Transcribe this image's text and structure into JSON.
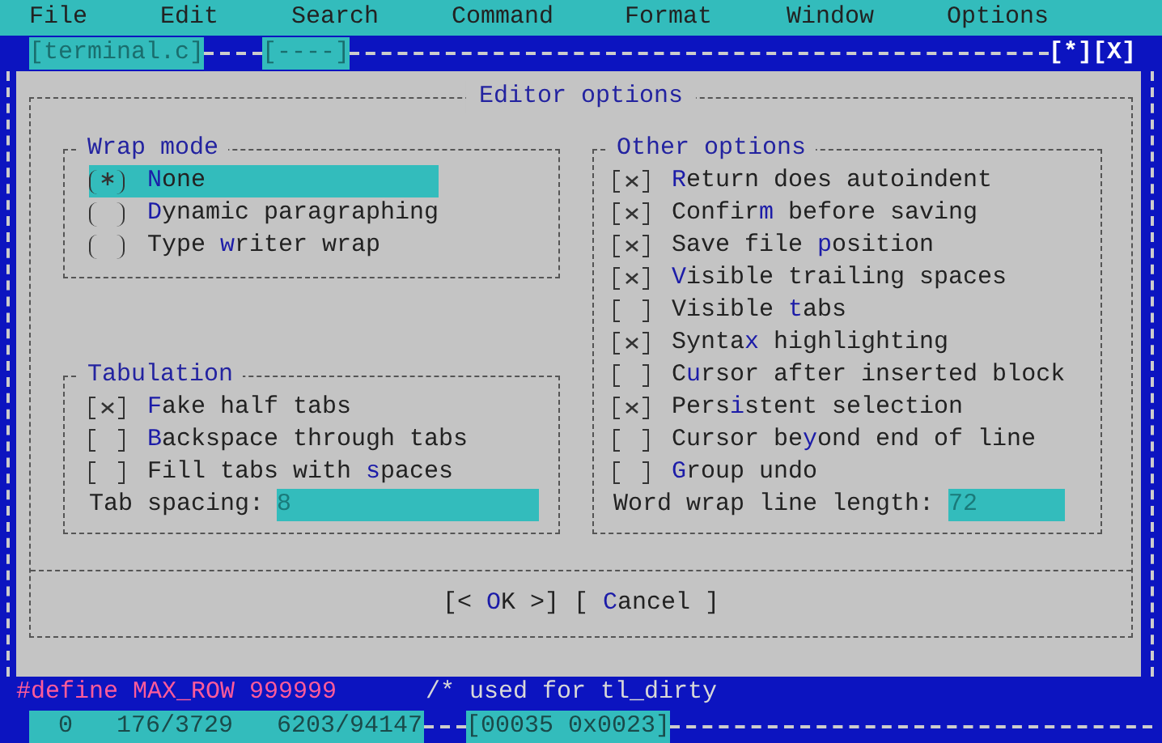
{
  "menu": [
    "File",
    "Edit",
    "Search",
    "Command",
    "Format",
    "Window",
    "Options"
  ],
  "editor_tabs": [
    {
      "label": "[terminal.c]"
    },
    {
      "label": "[----]"
    }
  ],
  "window_controls": "[*][X]",
  "dialog": {
    "title": "Editor options",
    "wrap_mode": {
      "title": "Wrap mode",
      "options": [
        {
          "label": {
            "key": "N",
            "after": "one"
          },
          "selected": true,
          "focused": true
        },
        {
          "label": {
            "key": "D",
            "after": "ynamic paragraphing"
          },
          "selected": false,
          "focused": false
        },
        {
          "label": {
            "before": "Type ",
            "key": "w",
            "after": "riter wrap"
          },
          "selected": false,
          "focused": false
        }
      ]
    },
    "tabulation": {
      "title": "Tabulation",
      "options": [
        {
          "label": {
            "key": "F",
            "after": "ake half tabs"
          },
          "checked": true
        },
        {
          "label": {
            "key": "B",
            "after": "ackspace through tabs"
          },
          "checked": false
        },
        {
          "label": {
            "before": "Fill tabs with ",
            "key": "s",
            "after": "paces"
          },
          "checked": false
        }
      ],
      "field": {
        "label": "Tab spacing:",
        "value": "8"
      }
    },
    "other": {
      "title": "Other options",
      "options": [
        {
          "label": {
            "key": "R",
            "after": "eturn does autoindent"
          },
          "checked": true
        },
        {
          "label": {
            "before": "Confir",
            "key": "m",
            "after": " before saving"
          },
          "checked": true
        },
        {
          "label": {
            "before": "Save file ",
            "key": "p",
            "after": "osition"
          },
          "checked": true
        },
        {
          "label": {
            "key": "V",
            "after": "isible trailing spaces"
          },
          "checked": true
        },
        {
          "label": {
            "before": "Visible ",
            "key": "t",
            "after": "abs"
          },
          "checked": false
        },
        {
          "label": {
            "before": "Synta",
            "key": "x",
            "after": " highlighting"
          },
          "checked": true
        },
        {
          "label": {
            "before": "C",
            "key": "u",
            "after": "rsor after inserted block"
          },
          "checked": false
        },
        {
          "label": {
            "before": "Pers",
            "key": "i",
            "after": "stent selection"
          },
          "checked": true
        },
        {
          "label": {
            "before": "Cursor be",
            "key": "y",
            "after": "ond end of line"
          },
          "checked": false
        },
        {
          "label": {
            "key": "G",
            "after": "roup undo"
          },
          "checked": false
        }
      ],
      "field": {
        "label": "Word wrap line length:",
        "value": "72"
      }
    },
    "buttons": [
      {
        "label": {
          "before": "[< ",
          "key": "O",
          "after": "K >]"
        }
      },
      {
        "label": {
          "before": "[ ",
          "key": "C",
          "after": "ancel ]"
        }
      }
    ]
  },
  "code_line": {
    "directive": "#define MAX_ROW 999999",
    "comment": "/* used for tl_dirty"
  },
  "status_bar": {
    "position": "  0   176/3729   6203/94147",
    "char_code": "[00035 0x0023]"
  }
}
